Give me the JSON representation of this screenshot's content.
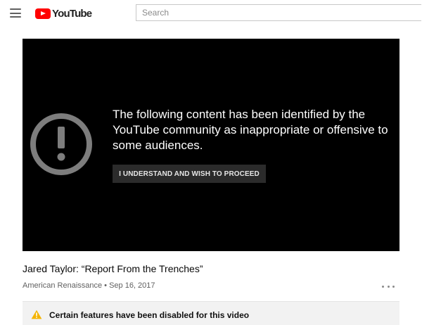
{
  "app": {
    "brand": "YouTube",
    "icons": {
      "menu": "hamburger-menu-icon",
      "logo": "youtube-play-icon",
      "warning_large": "exclamation-circle-icon",
      "warning_small": "warning-triangle-icon",
      "more": "more-horizontal-icon"
    },
    "colors": {
      "brand_red": "#ff0000",
      "player_bg": "#000000",
      "warning_yellow": "#f4b400"
    }
  },
  "header": {
    "search_placeholder": "Search"
  },
  "player": {
    "warning_message": "The following content has been identified by the YouTube community as inappropriate or offensive to some audiences.",
    "proceed_label": "I UNDERSTAND AND WISH TO PROCEED"
  },
  "video": {
    "title": "Jared Taylor: “Report From the Trenches”",
    "meta": "American Renaissance • Sep 16, 2017"
  },
  "notice": {
    "text": "Certain features have been disabled for this video"
  }
}
